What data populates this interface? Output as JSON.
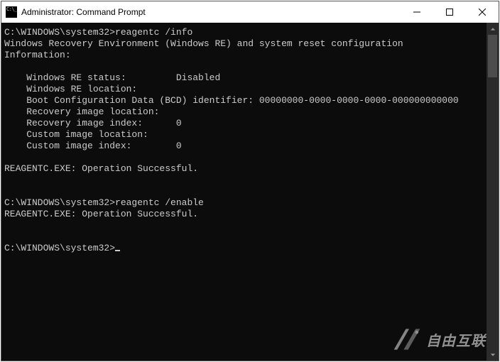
{
  "window": {
    "title": "Administrator: Command Prompt"
  },
  "terminal": {
    "prompt1_path": "C:\\WINDOWS\\system32>",
    "prompt1_cmd": "reagentc /info",
    "out_header": "Windows Recovery Environment (Windows RE) and system reset configuration",
    "out_info_label": "Information:",
    "kv_re_status_label": "    Windows RE status:         ",
    "kv_re_status_value": "Disabled",
    "kv_re_location": "    Windows RE location:",
    "kv_bcd_label": "    Boot Configuration Data (BCD) identifier: ",
    "kv_bcd_value": "00000000-0000-0000-0000-000000000000",
    "kv_rec_img_loc": "    Recovery image location:",
    "kv_rec_img_idx_label": "    Recovery image index:      ",
    "kv_rec_img_idx_value": "0",
    "kv_cust_img_loc": "    Custom image location:",
    "kv_cust_img_idx_label": "    Custom image index:        ",
    "kv_cust_img_idx_value": "0",
    "result1": "REAGENTC.EXE: Operation Successful.",
    "prompt2_path": "C:\\WINDOWS\\system32>",
    "prompt2_cmd": "reagentc /enable",
    "result2": "REAGENTC.EXE: Operation Successful.",
    "prompt3_path": "C:\\WINDOWS\\system32>"
  },
  "watermark": {
    "text": "自由互联"
  }
}
